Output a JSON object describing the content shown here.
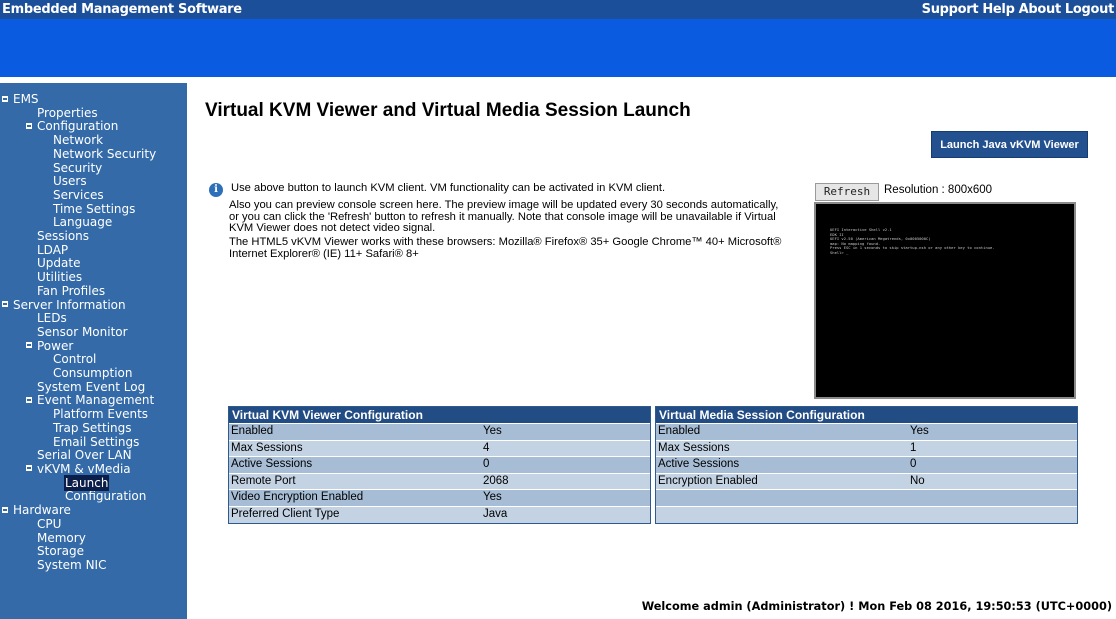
{
  "header": {
    "app_title": "Embedded Management Software",
    "links": [
      "Support",
      "Help",
      "About",
      "Logout"
    ]
  },
  "sidebar": {
    "items": [
      {
        "label": "EMS",
        "level": 0,
        "expandable": true
      },
      {
        "label": "Properties",
        "level": 1
      },
      {
        "label": "Configuration",
        "level": 1,
        "expandable": true
      },
      {
        "label": "Network",
        "level": 2
      },
      {
        "label": "Network Security",
        "level": 2
      },
      {
        "label": "Security",
        "level": 2
      },
      {
        "label": "Users",
        "level": 2
      },
      {
        "label": "Services",
        "level": 2
      },
      {
        "label": "Time Settings",
        "level": 2
      },
      {
        "label": "Language",
        "level": 2
      },
      {
        "label": "Sessions",
        "level": 1
      },
      {
        "label": "LDAP",
        "level": 1
      },
      {
        "label": "Update",
        "level": 1
      },
      {
        "label": "Utilities",
        "level": 1
      },
      {
        "label": "Fan Profiles",
        "level": 1
      },
      {
        "label": "Server Information",
        "level": 0,
        "expandable": true
      },
      {
        "label": "LEDs",
        "level": 1
      },
      {
        "label": "Sensor Monitor",
        "level": 1
      },
      {
        "label": "Power",
        "level": 1,
        "expandable": true
      },
      {
        "label": "Control",
        "level": 2
      },
      {
        "label": "Consumption",
        "level": 2
      },
      {
        "label": "System Event Log",
        "level": 1
      },
      {
        "label": "Event Management",
        "level": 1,
        "expandable": true
      },
      {
        "label": "Platform Events",
        "level": 2
      },
      {
        "label": "Trap Settings",
        "level": 2
      },
      {
        "label": "Email Settings",
        "level": 2
      },
      {
        "label": "Serial Over LAN",
        "level": 1
      },
      {
        "label": "vKVM & vMedia",
        "level": 1,
        "expandable": true
      },
      {
        "label": "Launch",
        "level": 2,
        "active": true
      },
      {
        "label": "Configuration",
        "level": 2
      },
      {
        "label": "Hardware",
        "level": 0,
        "expandable": true
      },
      {
        "label": "CPU",
        "level": 1
      },
      {
        "label": "Memory",
        "level": 1
      },
      {
        "label": "Storage",
        "level": 1
      },
      {
        "label": "System NIC",
        "level": 1
      }
    ]
  },
  "main": {
    "title": "Virtual KVM Viewer and Virtual Media Session Launch",
    "launch_button": "Launch Java vKVM Viewer",
    "info": {
      "line1": "Use above button to launch KVM client. VM functionality can be activated in KVM client.",
      "line2": "Also you can preview console screen here. The preview image will be updated every 30 seconds automatically, or you can click the 'Refresh' button to refresh it manually. Note that console image will be unavailable if Virtual KVM Viewer does not detect video signal.",
      "line3": "The HTML5 vKVM Viewer works with these browsers:  Mozilla® Firefox® 35+ Google Chrome™ 40+ Microsoft® Internet Explorer® (IE) 11+ Safari® 8+"
    },
    "refresh_button": "Refresh",
    "resolution": "Resolution : 800x600",
    "console_text": "UEFI Interactive Shell v2.1\nEDK II\nUEFI v2.50 (American Megatrends, 0x0005000C)\nmap: No mapping found.\nPress ESC in 1 seconds to skip startup.nsh or any other key to continue.\nShell> _"
  },
  "kvm_config": {
    "title": "Virtual KVM Viewer Configuration",
    "rows": [
      {
        "key": "Enabled",
        "value": "Yes"
      },
      {
        "key": "Max Sessions",
        "value": "4"
      },
      {
        "key": "Active Sessions",
        "value": "0"
      },
      {
        "key": "Remote Port",
        "value": "2068"
      },
      {
        "key": "Video Encryption Enabled",
        "value": "Yes"
      },
      {
        "key": "Preferred Client Type",
        "value": "Java"
      }
    ]
  },
  "vm_config": {
    "title": "Virtual Media Session Configuration",
    "rows": [
      {
        "key": "Enabled",
        "value": "Yes"
      },
      {
        "key": "Max Sessions",
        "value": "1"
      },
      {
        "key": "Active Sessions",
        "value": "0"
      },
      {
        "key": "Encryption Enabled",
        "value": "No"
      },
      {
        "key": "",
        "value": ""
      },
      {
        "key": "",
        "value": ""
      }
    ]
  },
  "footer": {
    "welcome": "Welcome admin (Administrator) !  Mon Feb 08 2016, 19:50:53 (UTC+0000)"
  },
  "colors": {
    "topbar": "#1c4f99",
    "banner": "#0a5be0",
    "sidebar": "#336aa7",
    "table_header": "#224c84",
    "row_dark": "#a7bdd5",
    "row_light": "#c3d3e4"
  }
}
